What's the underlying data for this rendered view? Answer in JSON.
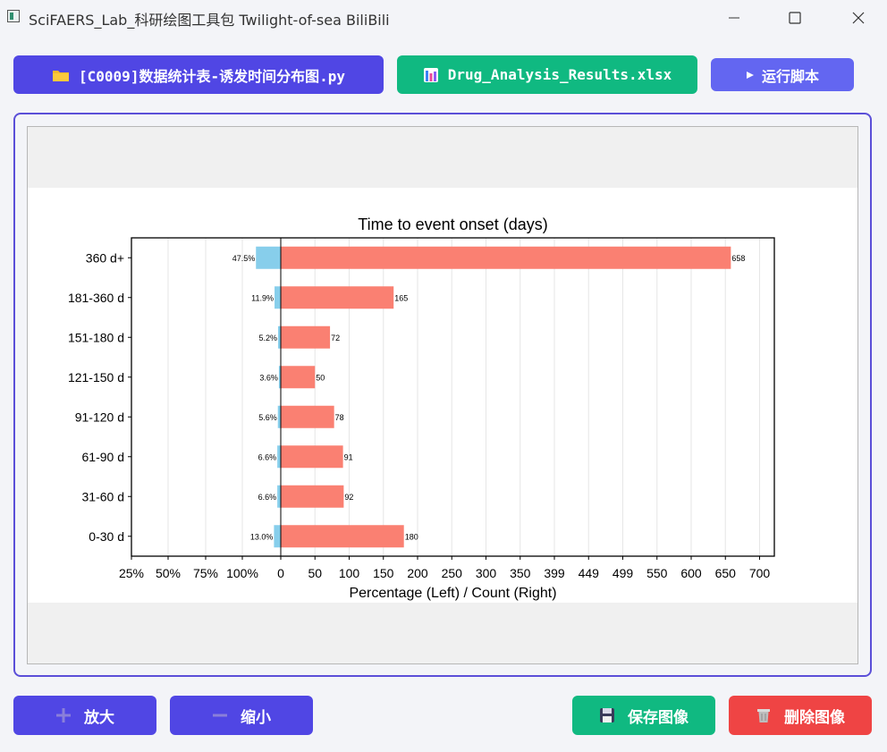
{
  "window": {
    "title": "SciFAERS_Lab_科研绘图工具包 Twilight-of-sea BiliBili"
  },
  "toolbar": {
    "script_button": "[C0009]数据统计表-诱发时间分布图.py",
    "data_button": "Drug_Analysis_Results.xlsx",
    "run_button": "运行脚本"
  },
  "bottom_bar": {
    "zoom_in": "放大",
    "zoom_out": "缩小",
    "save": "保存图像",
    "delete": "删除图像"
  },
  "colors": {
    "primary": "#5046e4",
    "run": "#6366f1",
    "green": "#10b981",
    "red": "#ef4444",
    "percent_bar": "#87ceeb",
    "count_bar": "#fa8072"
  },
  "chart_data": {
    "type": "bar",
    "title": "Time to event onset (days)",
    "xlabel": "Percentage (Left) / Count (Right)",
    "ylabel": "",
    "categories": [
      "360 d+",
      "181-360 d",
      "151-180 d",
      "121-150 d",
      "91-120 d",
      "61-90 d",
      "31-60 d",
      "0-30 d"
    ],
    "series": [
      {
        "values": [
          47.5,
          11.9,
          5.2,
          3.6,
          5.6,
          6.6,
          6.6,
          13.0
        ],
        "labels": [
          "47.5%",
          "11.9%",
          "5.2%",
          "3.6%",
          "5.6%",
          "6.6%",
          "6.6%",
          "13.0%"
        ]
      },
      {
        "values": [
          658,
          165,
          72,
          50,
          78,
          91,
          92,
          180
        ],
        "labels": [
          "658",
          "165",
          "72",
          "50",
          "78",
          "91",
          "92",
          "180"
        ]
      }
    ],
    "left_ticks": [
      "25%",
      "50%",
      "75%",
      "100%"
    ],
    "right_ticks": [
      "0",
      "50",
      "100",
      "150",
      "200",
      "250",
      "300",
      "350",
      "399",
      "449",
      "499",
      "550",
      "600",
      "650",
      "700"
    ],
    "xlim": [
      -220,
      720
    ],
    "grid": true
  }
}
